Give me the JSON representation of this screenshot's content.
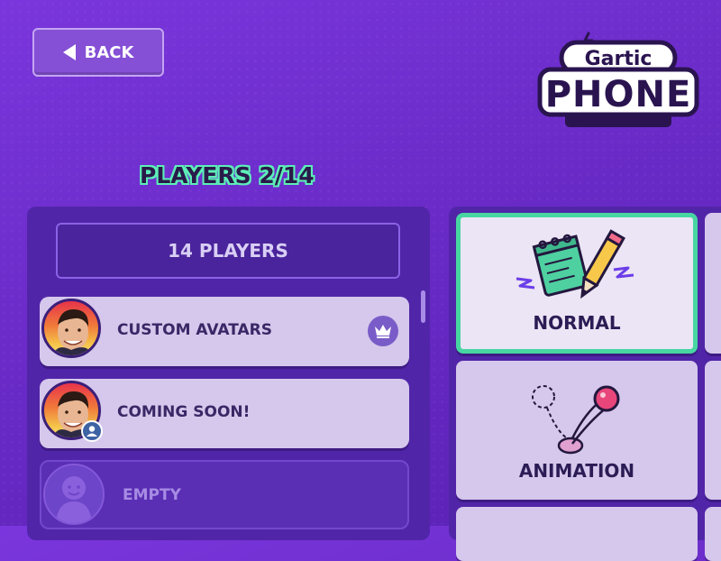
{
  "header": {
    "back_label": "BACK",
    "logo_top": "Gartic",
    "logo_bottom": "PHONE"
  },
  "players": {
    "title": "PLAYERS 2/14",
    "max_label": "14 PLAYERS",
    "list": [
      {
        "name": "CUSTOM AVATARS",
        "badge": "crown-icon"
      },
      {
        "name": "COMING SOON!",
        "badge": "user-icon"
      },
      {
        "name": "EMPTY",
        "badge": ""
      }
    ]
  },
  "modes": {
    "selected": "NORMAL",
    "items": [
      {
        "label": "NORMAL",
        "icon": "notebook-pencil-icon"
      },
      {
        "label": "ANIMATION",
        "icon": "bouncing-ball-icon"
      }
    ]
  },
  "colors": {
    "background": "#6a2bc8",
    "panel": "#5125a8",
    "selected_border": "#47d6a2",
    "title_outline": "#5cf0b8"
  }
}
